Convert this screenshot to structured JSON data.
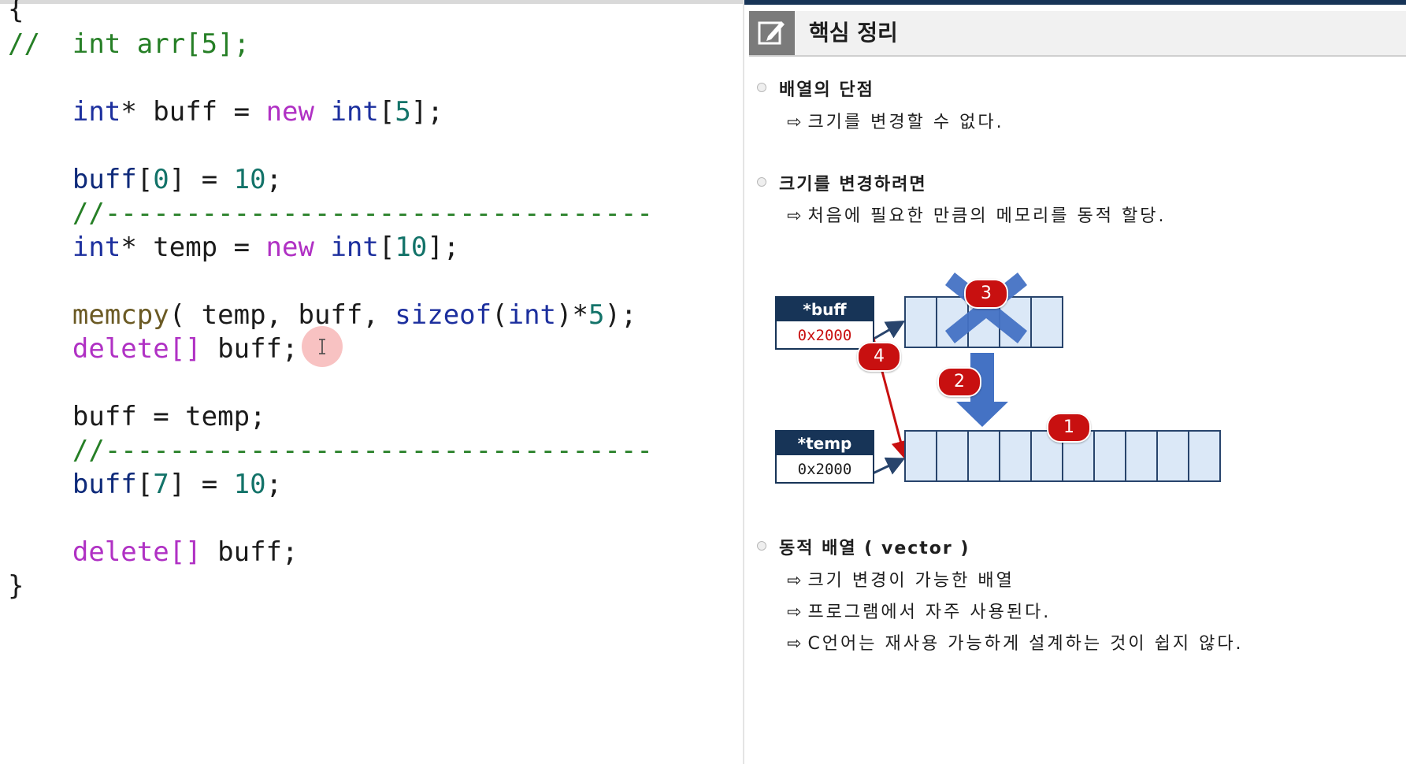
{
  "code": {
    "lines": [
      [
        {
          "t": "{",
          "c": "plain"
        }
      ],
      [
        {
          "t": "//  int arr[5];",
          "c": "comment"
        }
      ],
      [],
      [
        {
          "t": "    ",
          "c": "plain"
        },
        {
          "t": "int",
          "c": "type"
        },
        {
          "t": "* ",
          "c": "plain"
        },
        {
          "t": "buff",
          "c": "plain"
        },
        {
          "t": " = ",
          "c": "plain"
        },
        {
          "t": "new",
          "c": "kw"
        },
        {
          "t": " ",
          "c": "plain"
        },
        {
          "t": "int",
          "c": "type"
        },
        {
          "t": "[",
          "c": "plain"
        },
        {
          "t": "5",
          "c": "num"
        },
        {
          "t": "];",
          "c": "plain"
        }
      ],
      [],
      [
        {
          "t": "    ",
          "c": "plain"
        },
        {
          "t": "buff",
          "c": "var"
        },
        {
          "t": "[",
          "c": "plain"
        },
        {
          "t": "0",
          "c": "num"
        },
        {
          "t": "] = ",
          "c": "plain"
        },
        {
          "t": "10",
          "c": "num"
        },
        {
          "t": ";",
          "c": "plain"
        }
      ],
      [
        {
          "t": "    //----------------------------------",
          "c": "comment"
        }
      ],
      [
        {
          "t": "    ",
          "c": "plain"
        },
        {
          "t": "int",
          "c": "type"
        },
        {
          "t": "* temp = ",
          "c": "plain"
        },
        {
          "t": "new",
          "c": "kw"
        },
        {
          "t": " ",
          "c": "plain"
        },
        {
          "t": "int",
          "c": "type"
        },
        {
          "t": "[",
          "c": "plain"
        },
        {
          "t": "10",
          "c": "num"
        },
        {
          "t": "];",
          "c": "plain"
        }
      ],
      [],
      [
        {
          "t": "    ",
          "c": "plain"
        },
        {
          "t": "memcpy",
          "c": "fn"
        },
        {
          "t": "( temp, buff, ",
          "c": "plain"
        },
        {
          "t": "sizeof",
          "c": "type"
        },
        {
          "t": "(",
          "c": "plain"
        },
        {
          "t": "int",
          "c": "type"
        },
        {
          "t": ")*",
          "c": "plain"
        },
        {
          "t": "5",
          "c": "num"
        },
        {
          "t": ");",
          "c": "plain"
        }
      ],
      [
        {
          "t": "    ",
          "c": "plain"
        },
        {
          "t": "delete[]",
          "c": "kw"
        },
        {
          "t": " buff;",
          "c": "plain"
        }
      ],
      [],
      [
        {
          "t": "    buff = temp;",
          "c": "plain"
        }
      ],
      [
        {
          "t": "    //----------------------------------",
          "c": "comment"
        }
      ],
      [
        {
          "t": "    ",
          "c": "plain"
        },
        {
          "t": "buff",
          "c": "var"
        },
        {
          "t": "[",
          "c": "plain"
        },
        {
          "t": "7",
          "c": "num"
        },
        {
          "t": "] = ",
          "c": "plain"
        },
        {
          "t": "10",
          "c": "num"
        },
        {
          "t": ";",
          "c": "plain"
        }
      ],
      [],
      [
        {
          "t": "    ",
          "c": "plain"
        },
        {
          "t": "delete[]",
          "c": "kw"
        },
        {
          "t": " buff;",
          "c": "plain"
        }
      ],
      [
        {
          "t": "}",
          "c": "plain"
        }
      ]
    ]
  },
  "slide": {
    "title": "핵심 정리",
    "icons": {
      "header": "edit-icon",
      "bullet": "bullet-icon",
      "arrow": "arrow-right-icon"
    },
    "arrow_glyph": "⇨",
    "sections": [
      {
        "title": "배열의 단점",
        "items": [
          "크기를 변경할 수 없다."
        ]
      },
      {
        "title": "크기를 변경하려면",
        "items": [
          "처음에 필요한 만큼의 메모리를 동적 할당."
        ]
      },
      {
        "title": "동적 배열 ( vector )",
        "items": [
          "크기 변경이 가능한 배열",
          "프로그램에서 자주 사용된다.",
          "C언어는 재사용 가능하게 설계하는 것이 쉽지 않다."
        ]
      }
    ],
    "diagram": {
      "buff": {
        "name": "*buff",
        "value": "0x2000"
      },
      "temp": {
        "name": "*temp",
        "value": "0x2000"
      },
      "small_array_cells": 5,
      "large_array_cells": 10,
      "badges": [
        "1",
        "2",
        "3",
        "4"
      ],
      "colors": {
        "pointer_header": "#173457",
        "cell_fill": "#dbe8f7",
        "badge": "#c81010",
        "arrow": "#4472c4",
        "pointer_line": "#c81010",
        "buff_value": "#c81010"
      }
    }
  }
}
